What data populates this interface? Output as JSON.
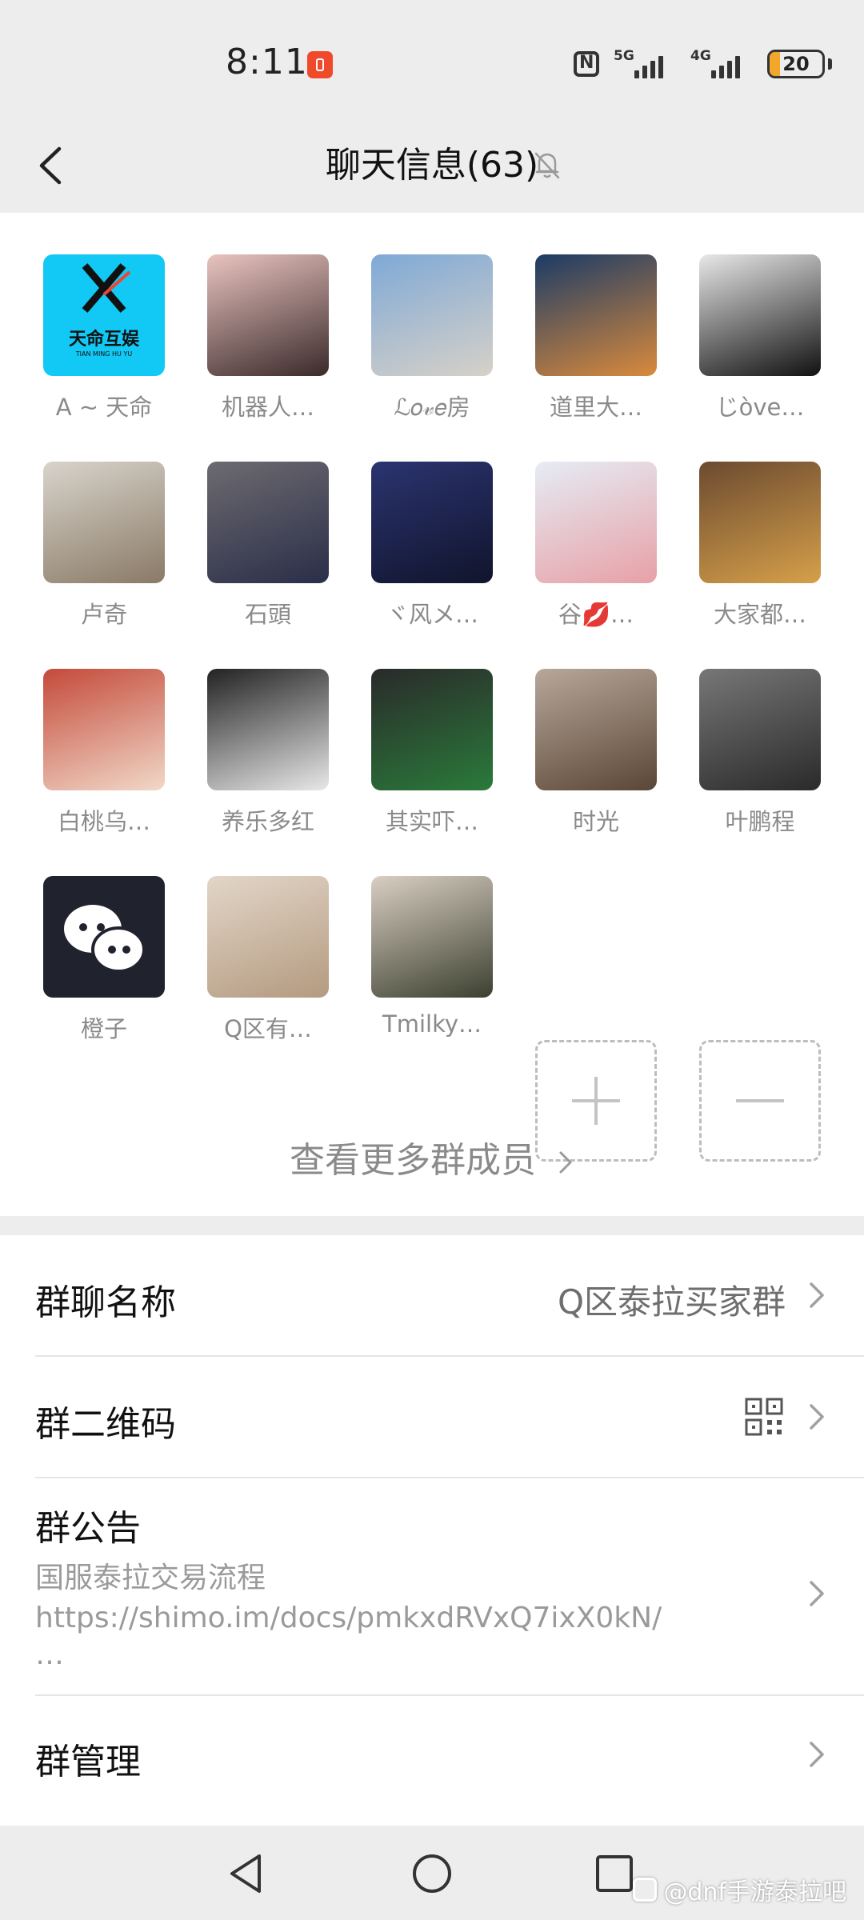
{
  "status_bar": {
    "time": "8:11",
    "signal_1_label": "5G",
    "signal_2_label": "4G",
    "battery_level": "20",
    "battery_fraction": 0.2,
    "battery_color": "#f2a72a",
    "icons": [
      "recording-icon",
      "nfc-icon",
      "signal-icon",
      "battery-icon"
    ]
  },
  "header": {
    "title": "聊天信息(63)",
    "back_icon": "chevron-left-icon",
    "mute_icon": "bell-off-icon"
  },
  "members": [
    {
      "name": "A ~ 天命",
      "avatar_text": "天命互娱",
      "avatar_subtext": "TIAN MING HU YU",
      "colors": [
        "#12c8f4",
        "#12c8f4"
      ]
    },
    {
      "name": "机器人…",
      "colors": [
        "#e9c4c0",
        "#3a2a2a"
      ]
    },
    {
      "name": "ℒ𝑜𝓋𝑒房",
      "colors": [
        "#7fa9d6",
        "#d6d1c8"
      ]
    },
    {
      "name": "道里大…",
      "colors": [
        "#1b3b66",
        "#d98a3c"
      ]
    },
    {
      "name": "じòve…",
      "colors": [
        "#e8e8e8",
        "#111111"
      ]
    },
    {
      "name": "卢奇",
      "colors": [
        "#d8d4cc",
        "#8a7a66"
      ]
    },
    {
      "name": "石頭",
      "colors": [
        "#6d6a70",
        "#2a2e48"
      ]
    },
    {
      "name": "ヾ风メ…",
      "colors": [
        "#2b3470",
        "#10142c"
      ]
    },
    {
      "name": "谷💋…",
      "colors": [
        "#e6ecf5",
        "#e7a0a6"
      ]
    },
    {
      "name": "大家都…",
      "colors": [
        "#6b4a30",
        "#d6a04a"
      ]
    },
    {
      "name": "白桃乌…",
      "colors": [
        "#c44a3a",
        "#f1d8c8"
      ]
    },
    {
      "name": "养乐多红",
      "colors": [
        "#222222",
        "#e8e8e8"
      ]
    },
    {
      "name": "其实吓…",
      "colors": [
        "#2a2a2a",
        "#2a7a3a"
      ]
    },
    {
      "name": "时光",
      "colors": [
        "#b8a89a",
        "#5a4636"
      ]
    },
    {
      "name": "叶鹏程",
      "colors": [
        "#777777",
        "#2a2a2a"
      ]
    },
    {
      "name": "橙子",
      "colors": [
        "#20222e",
        "#20222e"
      ]
    },
    {
      "name": "Q区有…",
      "colors": [
        "#e2d6c8",
        "#b49a80"
      ]
    },
    {
      "name": "Tmilky…",
      "colors": [
        "#d9cfc2",
        "#3c4030"
      ]
    }
  ],
  "add_member_icon": "plus-icon",
  "remove_member_icon": "minus-icon",
  "more_members_label": "查看更多群成员",
  "settings": {
    "group_name_label": "群聊名称",
    "group_name_value": "Q区泰拉买家群",
    "qr_code_label": "群二维码",
    "qr_icon": "qr-code-icon",
    "notice_label": "群公告",
    "notice_line1": "国服泰拉交易流程",
    "notice_line2": "https://shimo.im/docs/pmkxdRVxQ7ixX0kN/",
    "notice_line3": "…",
    "manage_label": "群管理"
  },
  "nav_bar": {
    "back_icon": "triangle-back-icon",
    "home_icon": "circle-home-icon",
    "recents_icon": "square-recents-icon"
  },
  "watermark": "@dnf手游泰拉吧"
}
